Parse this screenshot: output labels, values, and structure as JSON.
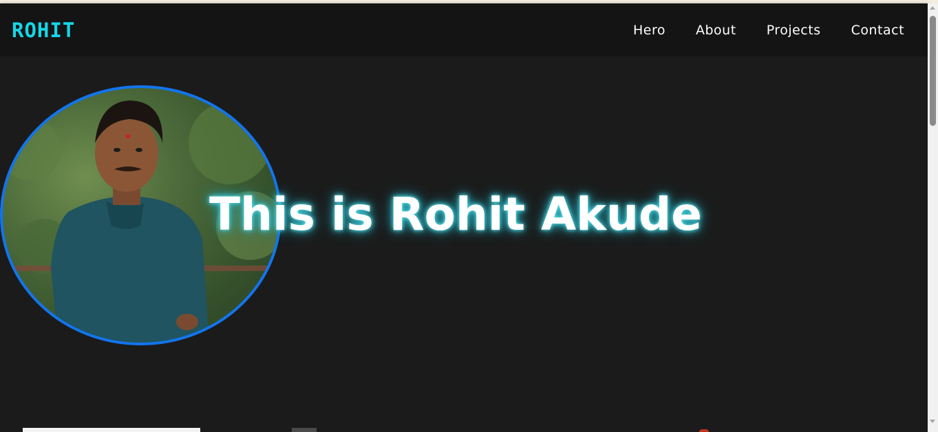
{
  "navbar": {
    "logo": "ROHIT",
    "links": [
      "Hero",
      "About",
      "Projects",
      "Contact"
    ]
  },
  "hero": {
    "title": "This is Rohit Akude",
    "avatar_icon": "profile-photo"
  },
  "colors": {
    "logo": "#16d6e8",
    "accent_border": "#1275ee",
    "background": "#1b1b1b",
    "navbar": "#141414",
    "title_glow": "#2fb9c9"
  }
}
